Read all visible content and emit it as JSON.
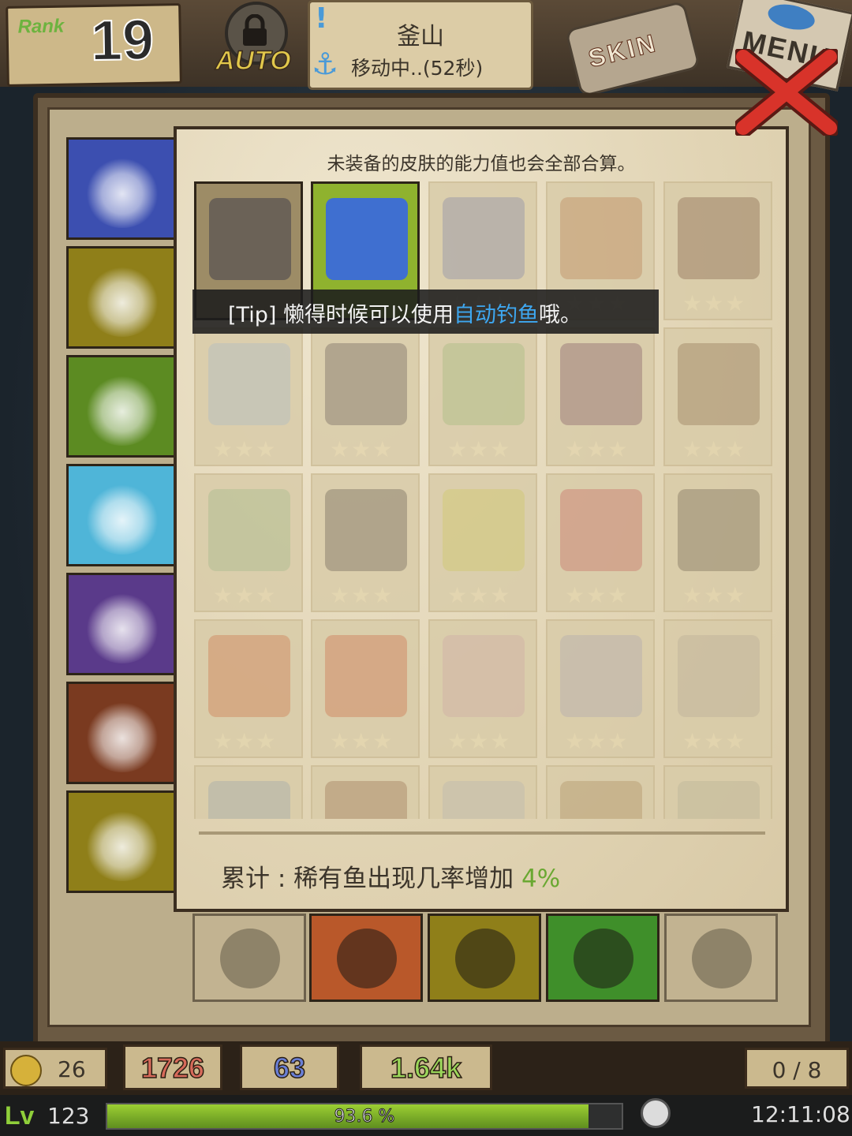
{
  "header": {
    "rank_label": "Rank",
    "rank_value": "19",
    "auto_label": "AUTO",
    "location_name": "釜山",
    "location_status": "移动中..(52秒)",
    "skin_label": "SKIN",
    "menu_label": "MENU"
  },
  "tabs": [
    {
      "name": "fishing-rod",
      "color": "#3c4fb0"
    },
    {
      "name": "hat",
      "color": "#8f7f19"
    },
    {
      "name": "hair",
      "color": "#5c8b22"
    },
    {
      "name": "clothes",
      "color": "#4fb5d8",
      "active": true
    },
    {
      "name": "boat",
      "color": "#5a3a8a"
    },
    {
      "name": "backpack",
      "color": "#7a3a20"
    },
    {
      "name": "lantern",
      "color": "#8f7f19"
    }
  ],
  "skin_panel": {
    "note": "未装备的皮肤的能力值也会全部合算。",
    "tip_prefix": "[Tip] 懒得时候可以使用",
    "tip_link": "自动钓鱼",
    "tip_suffix": "哦。",
    "total_label": "累计 : 稀有鱼出现几率增加",
    "total_value": "4%",
    "items": [
      {
        "name": "pirate-outfit",
        "owned": true,
        "color": "#6b6257"
      },
      {
        "name": "sailor-swimsuit",
        "owned": true,
        "color": "#3f6fd0",
        "green": true
      },
      {
        "name": "school-uniform",
        "owned": false,
        "color": "#6a6fa0"
      },
      {
        "name": "flower-dress",
        "owned": false,
        "color": "#b06a3a"
      },
      {
        "name": "leather-jacket",
        "owned": false,
        "color": "#6a3f2a"
      },
      {
        "name": "white-apron",
        "owned": false,
        "color": "#9ab0c8"
      },
      {
        "name": "maid-dress",
        "owned": false,
        "color": "#4a4040"
      },
      {
        "name": "green-maid-dress",
        "owned": false,
        "color": "#8fb06a"
      },
      {
        "name": "witch-dress",
        "owned": false,
        "color": "#6a3a50"
      },
      {
        "name": "brown-coat",
        "owned": false,
        "color": "#7a5a3a"
      },
      {
        "name": "bikini",
        "owned": false,
        "color": "#8fb07a"
      },
      {
        "name": "skull-armor",
        "owned": false,
        "color": "#4a4038"
      },
      {
        "name": "raincoat",
        "owned": false,
        "color": "#c8c24a"
      },
      {
        "name": "red-dress",
        "owned": false,
        "color": "#c04a4a"
      },
      {
        "name": "fur-coat",
        "owned": false,
        "color": "#5a4a3a"
      },
      {
        "name": "red-hood",
        "owned": false,
        "color": "#c85a2a"
      },
      {
        "name": "red-skirt",
        "owned": false,
        "color": "#c8502a"
      },
      {
        "name": "pink-coat",
        "owned": false,
        "color": "#c89aa0"
      },
      {
        "name": "bell-collar",
        "owned": false,
        "color": "#a09ab0"
      },
      {
        "name": "white-coat",
        "owned": false,
        "color": "#b0a090"
      },
      {
        "name": "gray-jacket",
        "owned": false,
        "color": "#8a9aa8"
      },
      {
        "name": "brown-suit",
        "owned": false,
        "color": "#8a5a3a"
      },
      {
        "name": "white-shirt",
        "owned": false,
        "color": "#b0b0b0"
      },
      {
        "name": "hoodie",
        "owned": false,
        "color": "#a07a4a"
      },
      {
        "name": "striped-sweater",
        "owned": false,
        "color": "#b0a890"
      }
    ]
  },
  "equipment": [
    {
      "name": "cat-slot",
      "color": "#c8b896",
      "faded": true
    },
    {
      "name": "harpoon-slot",
      "color": "#b9582a"
    },
    {
      "name": "net-slot",
      "color": "#8f7f19"
    },
    {
      "name": "binoculars-slot",
      "color": "#3f8f2a"
    },
    {
      "name": "gem-slot",
      "color": "#c8b896",
      "faded": true
    }
  ],
  "stats": {
    "coins": "26",
    "stat1": "1726",
    "stat2": "63",
    "stat3": "1.64k",
    "slots": "0 / 8"
  },
  "level": {
    "label": "Lv",
    "value": "123",
    "xp_percent": 93.6,
    "xp_text": "93.6 %",
    "time": "12:11:08"
  }
}
